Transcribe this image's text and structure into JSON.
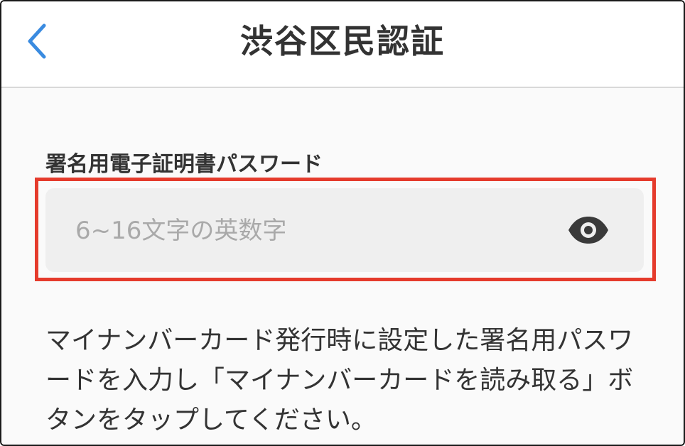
{
  "header": {
    "title": "渋谷区民認証",
    "back_icon": "chevron-left-icon",
    "back_color": "#3a8be0"
  },
  "form": {
    "password_label": "署名用電子証明書パスワード",
    "password_placeholder": "6~16文字の英数字",
    "password_value": "",
    "visibility_icon": "eye-icon",
    "highlight_color": "#e53b2c"
  },
  "instruction": {
    "text": "マイナンバーカード発行時に設定した署名用パスワードを入力し「マイナンバーカードを読み取る」ボタンをタップしてください。"
  }
}
